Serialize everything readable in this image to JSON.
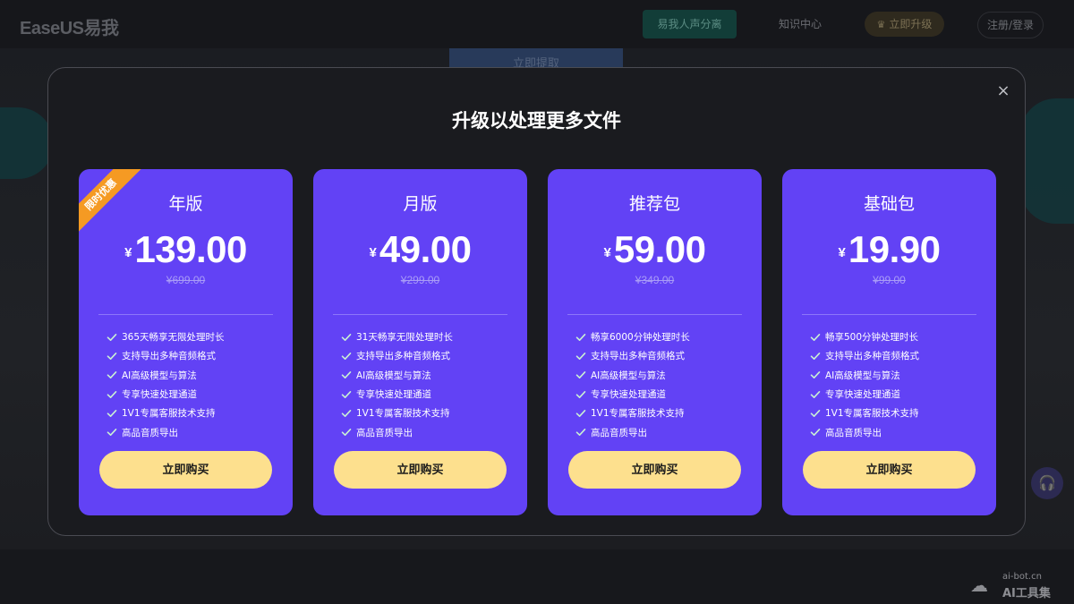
{
  "header": {
    "logo_text": "EaseUS易我",
    "nav_active": "易我人声分离",
    "nav_knowledge": "知识中心",
    "nav_upgrade": "立即升级",
    "nav_login": "注册/登录"
  },
  "background": {
    "extract_label": "立即提取"
  },
  "modal": {
    "title": "升级以处理更多文件",
    "close_glyph": "×"
  },
  "colors": {
    "card_bg": "#6242f5",
    "buy_button": "#fde08e",
    "ribbon": "#f59a23",
    "check": "#c9f0d4"
  },
  "plans": [
    {
      "name": "年版",
      "currency": "¥",
      "price": "139.00",
      "original_price": "¥699.00",
      "badge": "限时优惠",
      "features": [
        "365天畅享无限处理时长",
        "支持导出多种音频格式",
        "AI高级模型与算法",
        "专享快速处理通道",
        "1V1专属客服技术支持",
        "高品音质导出"
      ],
      "button": "立即购买"
    },
    {
      "name": "月版",
      "currency": "¥",
      "price": "49.00",
      "original_price": "¥299.00",
      "features": [
        "31天畅享无限处理时长",
        "支持导出多种音频格式",
        "AI高级模型与算法",
        "专享快速处理通道",
        "1V1专属客服技术支持",
        "高品音质导出"
      ],
      "button": "立即购买"
    },
    {
      "name": "推荐包",
      "currency": "¥",
      "price": "59.00",
      "original_price": "¥349.00",
      "features": [
        "畅享6000分钟处理时长",
        "支持导出多种音频格式",
        "AI高级模型与算法",
        "专享快速处理通道",
        "1V1专属客服技术支持",
        "高品音质导出"
      ],
      "button": "立即购买"
    },
    {
      "name": "基础包",
      "currency": "¥",
      "price": "19.90",
      "original_price": "¥99.00",
      "features": [
        "畅享500分钟处理时长",
        "支持导出多种音频格式",
        "AI高级模型与算法",
        "专享快速处理通道",
        "1V1专属客服技术支持",
        "高品音质导出"
      ],
      "button": "立即购买"
    }
  ],
  "watermark": {
    "top": "ai-bot.cn",
    "bottom": "AI工具集"
  }
}
